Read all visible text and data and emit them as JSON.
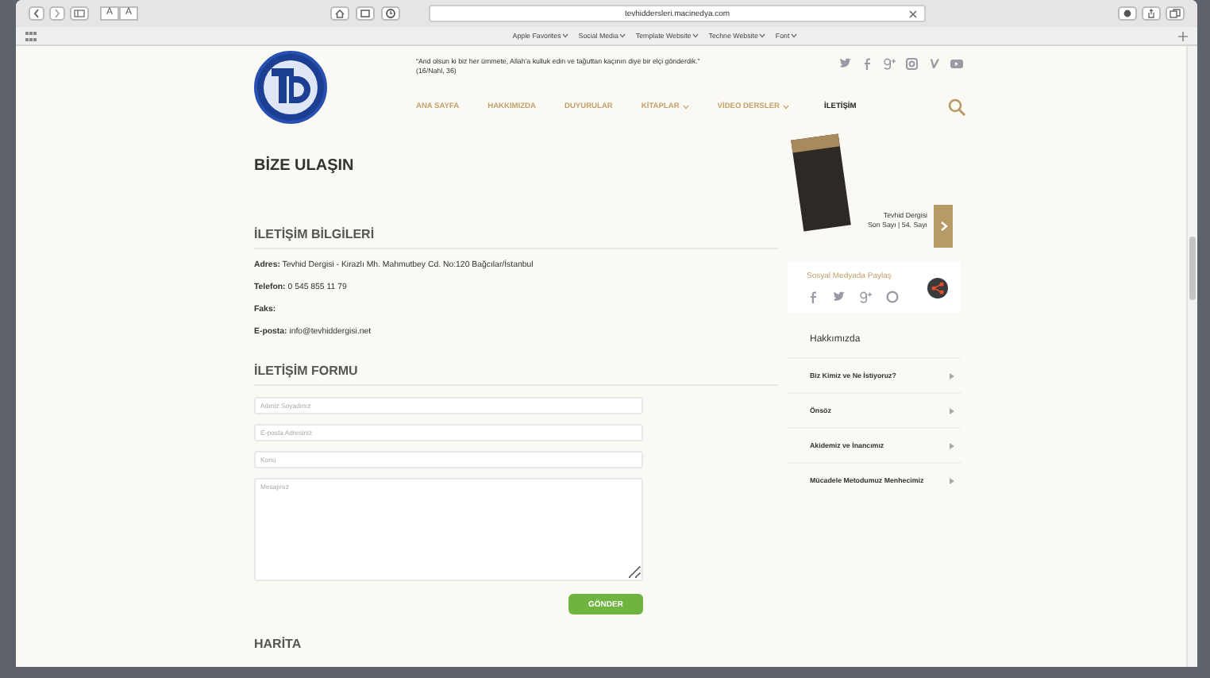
{
  "browser": {
    "text_size_buttons": [
      "A",
      "A"
    ],
    "url": "tevhiddersleri.macinedya.com",
    "bookmarks": [
      {
        "label": "Apple Favorites"
      },
      {
        "label": "Social Media"
      },
      {
        "label": "Template Website"
      },
      {
        "label": "Techne Website"
      },
      {
        "label": "Font"
      }
    ]
  },
  "header": {
    "quote": "“And olsun ki biz her ümmete, Allah'a kulluk edin ve tağuttan kaçının diye bir elçi gönderdik.”",
    "quote_source": "(16/Nahl, 36)",
    "nav": [
      {
        "label": "ANA SAYFA",
        "dropdown": false,
        "selected": false
      },
      {
        "label": "HAKKIMIZDA",
        "dropdown": false,
        "selected": false
      },
      {
        "label": "DUYURULAR",
        "dropdown": false,
        "selected": false
      },
      {
        "label": "KİTAPLAR",
        "dropdown": true,
        "selected": false
      },
      {
        "label": "VİDEO DERSLER",
        "dropdown": true,
        "selected": false
      },
      {
        "label": "İLETİŞİM",
        "dropdown": false,
        "selected": true
      }
    ]
  },
  "page_title": "BİZE ULAŞIN",
  "contact_info": {
    "heading": "İLETİŞİM BİLGİLERİ",
    "lines": [
      {
        "label": "Adres:",
        "value": "Tevhid Dergisi - Kirazlı Mh. Mahmutbey Cd. No:120 Bağcılar/İstanbul"
      },
      {
        "label": "Telefon:",
        "value": "0 545 855 11 79"
      },
      {
        "label": "Faks:"
      },
      {
        "label": "E-posta:",
        "value": "info@tevhiddergisi.net"
      }
    ]
  },
  "contact_form": {
    "heading": "İLETİŞİM FORMU",
    "fields": [
      {
        "kind": "input",
        "placeholder": "Adınız Soyadınız"
      },
      {
        "kind": "input",
        "placeholder": "E-posta Adresiniz"
      },
      {
        "kind": "input",
        "placeholder": "Konu"
      },
      {
        "kind": "textarea",
        "placeholder": "Mesajınız"
      }
    ],
    "submit": "GÖNDER"
  },
  "map_heading": "HARİTA",
  "sidebar": {
    "magazine_caption": [
      "Tevhid Dergisi",
      "Son Sayı | 54. Sayı"
    ],
    "share_title": "Sosyal Medyada Paylaş",
    "about": {
      "heading": "Hakkımızda",
      "items": [
        {
          "label": "Biz Kimiz ve Ne İstiyoruz?"
        },
        {
          "label": "Önsöz"
        },
        {
          "label": "Akidemiz ve İnancımız"
        },
        {
          "label": "Mücadele Metodumuz Menhecimiz"
        }
      ]
    }
  }
}
